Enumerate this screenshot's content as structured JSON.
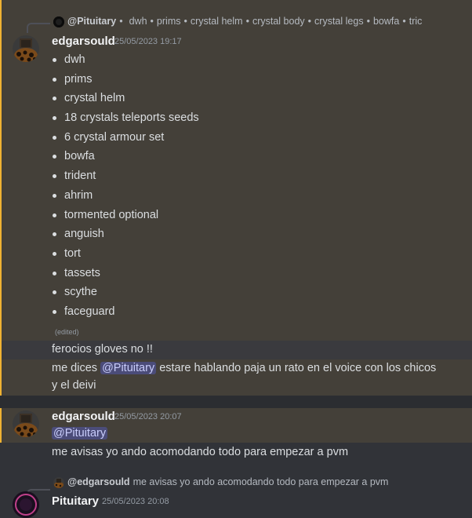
{
  "message1": {
    "reply": {
      "mention": "@Pituitary",
      "preview_items": [
        "dwh",
        "prims",
        "crystal helm",
        "crystal body",
        "crystal legs",
        "bowfa",
        "tric"
      ]
    },
    "author": "edgarsould",
    "timestamp": "25/05/2023 19:17",
    "items": [
      "dwh",
      "prims",
      "crystal helm",
      "18 crystals teleports seeds",
      "6 crystal armour set",
      "bowfa",
      "trident",
      "ahrim",
      "tormented optional",
      "anguish",
      "tort",
      "tassets",
      "scythe",
      "faceguard"
    ],
    "edited_label": "(edited)"
  },
  "message2": {
    "text": "ferocios gloves no !!"
  },
  "message3": {
    "text_before": "me dices",
    "mention": "@Pituitary",
    "text_after": " estare hablando paja un rato en el voice con los chicos",
    "text_line2": "y el deivi"
  },
  "message4": {
    "author": "edgarsould",
    "timestamp": "25/05/2023 20:07",
    "mention": "@Pituitary",
    "text": "me avisas yo ando acomodando todo para empezar a pvm"
  },
  "message5": {
    "reply": {
      "author": "@edgarsould",
      "preview": "me avisas yo ando acomodando todo para empezar a pvm"
    },
    "author": "Pituitary",
    "timestamp": "25/05/2023 20:08"
  },
  "colors": {
    "background": "#313338",
    "mention_highlight": "#444039",
    "mention_border": "#f0b232",
    "mention_pill": "#5865f2"
  }
}
